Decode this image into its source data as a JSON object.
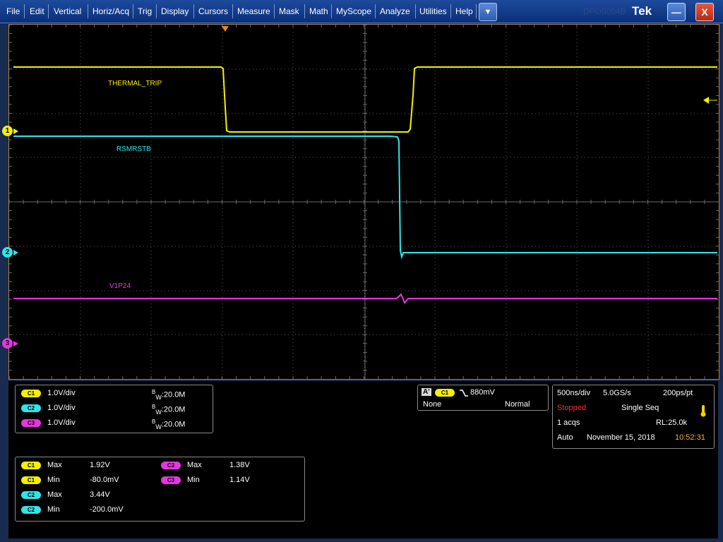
{
  "menu": {
    "items": [
      "File",
      "Edit",
      "Vertical",
      "Horiz/Acq",
      "Trig",
      "Display",
      "Cursors",
      "Measure",
      "Mask",
      "Math",
      "MyScope",
      "Analyze",
      "Utilities",
      "Help"
    ],
    "logo": "Tek",
    "ghost_text": "DPO5054B"
  },
  "colors": {
    "ch1": "#f4f000",
    "ch2": "#2ee6ea",
    "ch3": "#e834e4",
    "grid": "#5a5a5a",
    "trigger": "#e88a18"
  },
  "waveforms": {
    "ch1_label": "THERMAL_TRIP",
    "ch2_label": "RSMRSTB",
    "ch3_label": "V1P24"
  },
  "markers": {
    "ch1": "1",
    "ch2": "2",
    "ch3": "3"
  },
  "channels": [
    {
      "id": "C1",
      "scale": "1.0V/div",
      "bw_label": "W",
      "bw_value": ":20.0M"
    },
    {
      "id": "C2",
      "scale": "1.0V/div",
      "bw_label": "W",
      "bw_value": ":20.0M"
    },
    {
      "id": "C3",
      "scale": "1.0V/div",
      "bw_label": "W",
      "bw_value": ":20.0M"
    }
  ],
  "bw_prefix": "B",
  "trigger": {
    "tag": "A'",
    "source": "C1",
    "level": "880mV",
    "coupling": "None",
    "mode": "Normal"
  },
  "acquisition": {
    "timebase": "500ns/div",
    "sample_rate": "5.0GS/s",
    "resolution": "200ps/pt",
    "state": "Stopped",
    "run_mode": "Single Seq",
    "acqs": "1 acqs",
    "record_length": "RL:25.0k",
    "trigger_mode": "Auto",
    "date": "November 15, 2018",
    "time": "10:52:31"
  },
  "measurements": [
    {
      "src": "C1",
      "name": "Max",
      "value": "1.92V"
    },
    {
      "src": "C1",
      "name": "Min",
      "value": "-80.0mV"
    },
    {
      "src": "C2",
      "name": "Max",
      "value": "3.44V"
    },
    {
      "src": "C2",
      "name": "Min",
      "value": "-200.0mV"
    },
    {
      "src": "C3",
      "name": "Max",
      "value": "1.38V"
    },
    {
      "src": "C3",
      "name": "Min",
      "value": "1.14V"
    }
  ]
}
